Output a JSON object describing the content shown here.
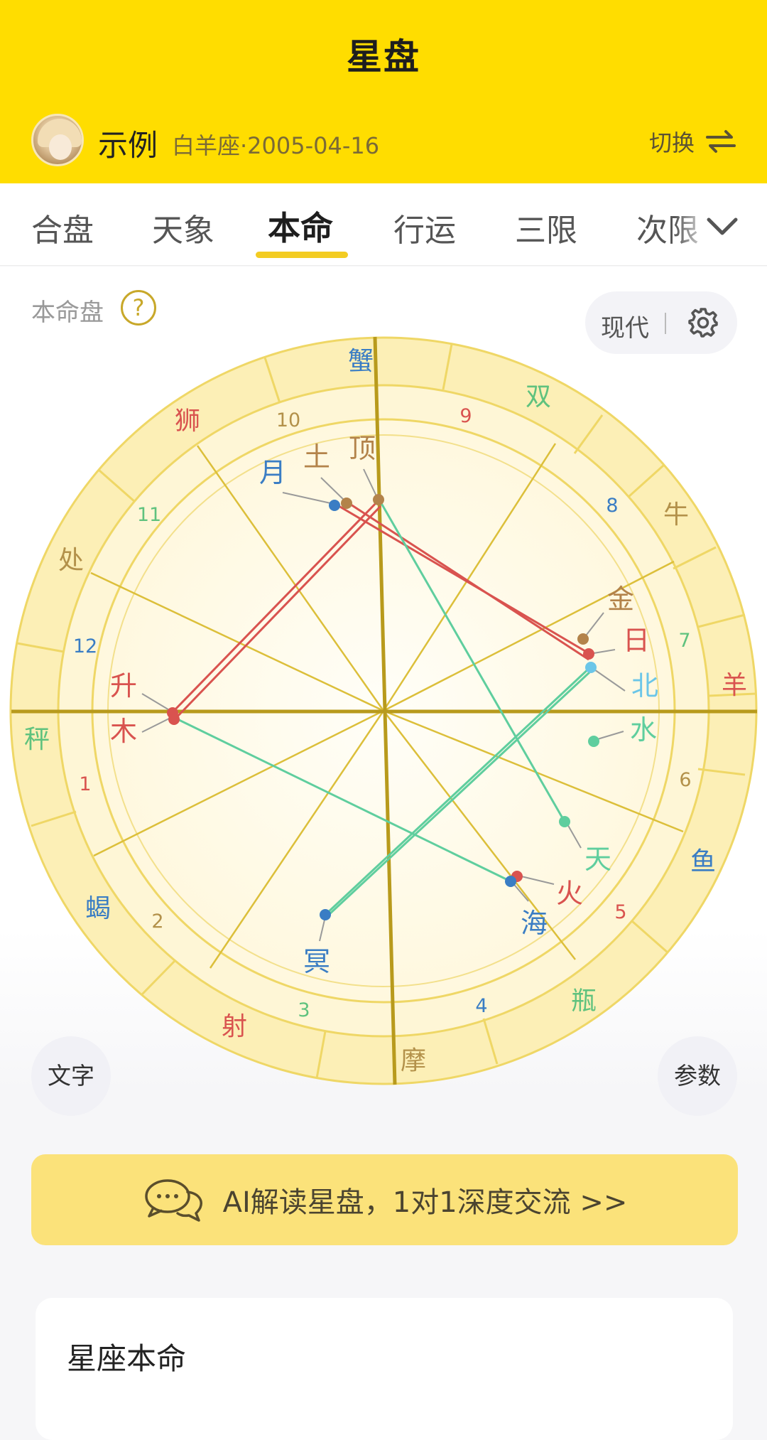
{
  "header": {
    "title": "星盘"
  },
  "profile": {
    "name": "示例",
    "subtitle": "白羊座·2005-04-16",
    "switch_label": "切换"
  },
  "tabs": [
    {
      "label": "合盘",
      "active": false
    },
    {
      "label": "天象",
      "active": false
    },
    {
      "label": "本命",
      "active": true
    },
    {
      "label": "行运",
      "active": false
    },
    {
      "label": "三限",
      "active": false
    },
    {
      "label": "次限",
      "active": false
    }
  ],
  "chart_section": {
    "label": "本命盘",
    "help": "?",
    "mode": "现代"
  },
  "wheel": {
    "signs": [
      "蟹",
      "双",
      "牛",
      "羊",
      "鱼",
      "瓶",
      "摩",
      "射",
      "蝎",
      "秤",
      "处",
      "狮"
    ],
    "houses": [
      "1",
      "2",
      "3",
      "4",
      "5",
      "6",
      "7",
      "8",
      "9",
      "10",
      "11",
      "12"
    ],
    "planets": [
      "升",
      "木",
      "月",
      "土",
      "顶",
      "金",
      "日",
      "北",
      "水",
      "天",
      "火",
      "海",
      "冥"
    ]
  },
  "buttons": {
    "text": "文字",
    "params": "参数"
  },
  "ai_banner": {
    "text": "AI解读星盘，1对1深度交流 >>"
  },
  "card": {
    "title": "星座本命"
  },
  "colors": {
    "brand_yellow": "#ffdd00",
    "banner": "#fbe27a",
    "red_aspect": "#d9534f",
    "green_aspect": "#5fce9e"
  }
}
